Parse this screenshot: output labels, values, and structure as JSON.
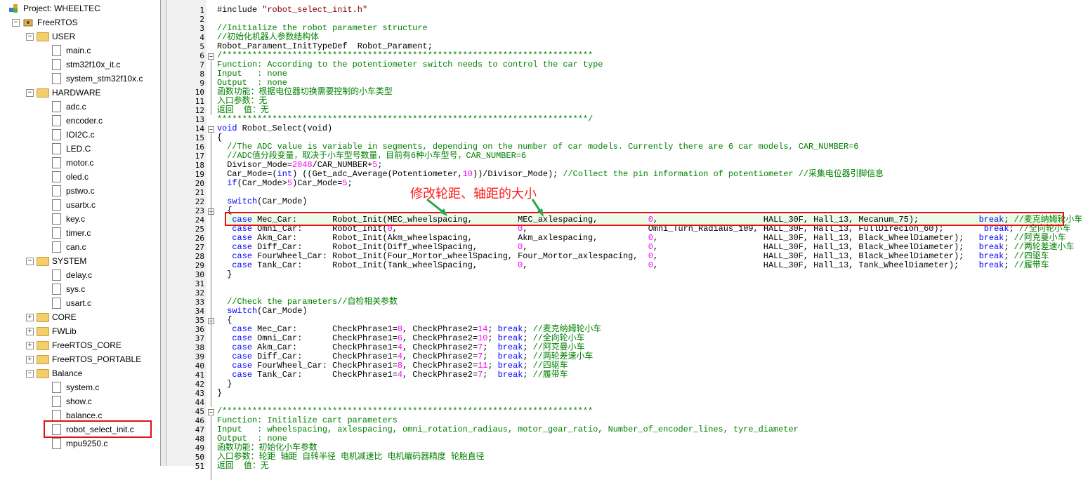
{
  "project": {
    "root_label": "Project: WHEELTEC",
    "target_label": "FreeRTOS",
    "groups": [
      {
        "name": "USER",
        "files": [
          "main.c",
          "stm32f10x_it.c",
          "system_stm32f10x.c"
        ]
      },
      {
        "name": "HARDWARE",
        "files": [
          "adc.c",
          "encoder.c",
          "IOI2C.c",
          "LED.C",
          "motor.c",
          "oled.c",
          "pstwo.c",
          "usartx.c",
          "key.c",
          "timer.c",
          "can.c"
        ]
      },
      {
        "name": "SYSTEM",
        "files": [
          "delay.c",
          "sys.c",
          "usart.c"
        ]
      },
      {
        "name": "CORE",
        "files": []
      },
      {
        "name": "FWLib",
        "files": []
      },
      {
        "name": "FreeRTOS_CORE",
        "files": []
      },
      {
        "name": "FreeRTOS_PORTABLE",
        "files": []
      },
      {
        "name": "Balance",
        "files": [
          "system.c",
          "show.c",
          "balance.c",
          "robot_select_init.c",
          "mpu9250.c"
        ]
      }
    ]
  },
  "annotation": "修改轮距、轴距的大小",
  "colors": {
    "comment": "#008000",
    "keyword": "#0000ff",
    "number": "#ff00ff",
    "highlight_border": "#e01010"
  },
  "code_lines": [
    [
      [
        "d",
        "#include "
      ],
      [
        "s",
        "\"robot_select_init.h\""
      ]
    ],
    [],
    [
      [
        "c",
        "//Initialize the robot parameter structure"
      ]
    ],
    [
      [
        "c",
        "//初始化机器人参数结构体"
      ]
    ],
    [
      [
        "d",
        "Robot_Parament_InitTypeDef  Robot_Parament;"
      ]
    ],
    [
      [
        "c",
        "/**************************************************************************"
      ]
    ],
    [
      [
        "c",
        "Function: According to the potentiometer switch needs to control the car type"
      ]
    ],
    [
      [
        "c",
        "Input   : none"
      ]
    ],
    [
      [
        "c",
        "Output  : none"
      ]
    ],
    [
      [
        "c",
        "函数功能：根据电位器切换需要控制的小车类型"
      ]
    ],
    [
      [
        "c",
        "入口参数：无"
      ]
    ],
    [
      [
        "c",
        "返回  值：无"
      ]
    ],
    [
      [
        "c",
        "**************************************************************************/"
      ]
    ],
    [
      [
        "k",
        "void"
      ],
      [
        "d",
        " Robot_Select(void)"
      ]
    ],
    [
      [
        "d",
        "{"
      ]
    ],
    [
      [
        "c",
        "  //The ADC value is variable in segments, depending on the number of car models. Currently there are 6 car models, CAR_NUMBER=6"
      ]
    ],
    [
      [
        "c",
        "  //ADC值分段变量，取决于小车型号数量，目前有6种小车型号，CAR_NUMBER=6"
      ]
    ],
    [
      [
        "d",
        "  Divisor_Mode="
      ],
      [
        "n",
        "2048"
      ],
      [
        "d",
        "/CAR_NUMBER+"
      ],
      [
        "n",
        "5"
      ],
      [
        "d",
        ";"
      ]
    ],
    [
      [
        "d",
        "  Car_Mode=("
      ],
      [
        "k",
        "int"
      ],
      [
        "d",
        ") ((Get_adc_Average(Potentiometer,"
      ],
      [
        "n",
        "10"
      ],
      [
        "d",
        "))/Divisor_Mode); "
      ],
      [
        "c",
        "//Collect the pin information of potentiometer //采集电位器引脚信息"
      ]
    ],
    [
      [
        "d",
        "  "
      ],
      [
        "k",
        "if"
      ],
      [
        "d",
        "(Car_Mode>"
      ],
      [
        "n",
        "5"
      ],
      [
        "d",
        ")Car_Mode="
      ],
      [
        "n",
        "5"
      ],
      [
        "d",
        ";"
      ]
    ],
    [],
    [
      [
        "d",
        "  "
      ],
      [
        "k",
        "switch"
      ],
      [
        "d",
        "(Car_Mode)"
      ]
    ],
    [
      [
        "d",
        "  {"
      ]
    ],
    [
      [
        "d",
        "   "
      ],
      [
        "k",
        "case"
      ],
      [
        "d",
        " Mec_Car:       Robot_Init(MEC_wheelspacing,         MEC_axlespacing,          "
      ],
      [
        "n",
        "0"
      ],
      [
        "d",
        ",                     HALL_30F, Hall_13, Mecanum_75);            "
      ],
      [
        "k",
        "break"
      ],
      [
        "d",
        "; "
      ],
      [
        "c",
        "//麦克纳姆轮小车"
      ]
    ],
    [
      [
        "d",
        "   "
      ],
      [
        "k",
        "case"
      ],
      [
        "d",
        " Omni_Car:      Robot_Init("
      ],
      [
        "n",
        "0"
      ],
      [
        "d",
        ",                        "
      ],
      [
        "n",
        "0"
      ],
      [
        "d",
        ",                        Omni_Turn_Radiaus_109, HALL_30F, Hall_13, FullDirecion_60);        "
      ],
      [
        "k",
        "break"
      ],
      [
        "d",
        "; "
      ],
      [
        "c",
        "//全向轮小车"
      ]
    ],
    [
      [
        "d",
        "   "
      ],
      [
        "k",
        "case"
      ],
      [
        "d",
        " Akm_Car:       Robot_Init(Akm_wheelspacing,         Akm_axlespacing,          "
      ],
      [
        "n",
        "0"
      ],
      [
        "d",
        ",                     HALL_30F, Hall_13, Black_WheelDiameter);   "
      ],
      [
        "k",
        "break"
      ],
      [
        "d",
        "; "
      ],
      [
        "c",
        "//阿克曼小车"
      ]
    ],
    [
      [
        "d",
        "   "
      ],
      [
        "k",
        "case"
      ],
      [
        "d",
        " Diff_Car:      Robot_Init(Diff_wheelSpacing,        "
      ],
      [
        "n",
        "0"
      ],
      [
        "d",
        ",                        "
      ],
      [
        "n",
        "0"
      ],
      [
        "d",
        ",                     HALL_30F, Hall_13, Black_WheelDiameter);   "
      ],
      [
        "k",
        "break"
      ],
      [
        "d",
        "; "
      ],
      [
        "c",
        "//两轮差速小车"
      ]
    ],
    [
      [
        "d",
        "   "
      ],
      [
        "k",
        "case"
      ],
      [
        "d",
        " FourWheel_Car: Robot_Init(Four_Mortor_wheelSpacing, Four_Mortor_axlespacing,  "
      ],
      [
        "n",
        "0"
      ],
      [
        "d",
        ",                     HALL_30F, Hall_13, Black_WheelDiameter);   "
      ],
      [
        "k",
        "break"
      ],
      [
        "d",
        "; "
      ],
      [
        "c",
        "//四驱车"
      ]
    ],
    [
      [
        "d",
        "   "
      ],
      [
        "k",
        "case"
      ],
      [
        "d",
        " Tank_Car:      Robot_Init(Tank_wheelSpacing,        "
      ],
      [
        "n",
        "0"
      ],
      [
        "d",
        ",                        "
      ],
      [
        "n",
        "0"
      ],
      [
        "d",
        ",                     HALL_30F, Hall_13, Tank_WheelDiameter);    "
      ],
      [
        "k",
        "break"
      ],
      [
        "d",
        "; "
      ],
      [
        "c",
        "//履带车"
      ]
    ],
    [
      [
        "d",
        "  }"
      ]
    ],
    [],
    [],
    [
      [
        "c",
        "  //Check the parameters//自检相关参数"
      ]
    ],
    [
      [
        "d",
        "  "
      ],
      [
        "k",
        "switch"
      ],
      [
        "d",
        "(Car_Mode)"
      ]
    ],
    [
      [
        "d",
        "  {"
      ]
    ],
    [
      [
        "d",
        "   "
      ],
      [
        "k",
        "case"
      ],
      [
        "d",
        " Mec_Car:       CheckPhrase1="
      ],
      [
        "n",
        "8"
      ],
      [
        "d",
        ", CheckPhrase2="
      ],
      [
        "n",
        "14"
      ],
      [
        "d",
        "; "
      ],
      [
        "k",
        "break"
      ],
      [
        "d",
        "; "
      ],
      [
        "c",
        "//麦克纳姆轮小车"
      ]
    ],
    [
      [
        "d",
        "   "
      ],
      [
        "k",
        "case"
      ],
      [
        "d",
        " Omni_Car:      CheckPhrase1="
      ],
      [
        "n",
        "6"
      ],
      [
        "d",
        ", CheckPhrase2="
      ],
      [
        "n",
        "10"
      ],
      [
        "d",
        "; "
      ],
      [
        "k",
        "break"
      ],
      [
        "d",
        "; "
      ],
      [
        "c",
        "//全向轮小车"
      ]
    ],
    [
      [
        "d",
        "   "
      ],
      [
        "k",
        "case"
      ],
      [
        "d",
        " Akm_Car:       CheckPhrase1="
      ],
      [
        "n",
        "4"
      ],
      [
        "d",
        ", CheckPhrase2="
      ],
      [
        "n",
        "7"
      ],
      [
        "d",
        ";  "
      ],
      [
        "k",
        "break"
      ],
      [
        "d",
        "; "
      ],
      [
        "c",
        "//阿克曼小车"
      ]
    ],
    [
      [
        "d",
        "   "
      ],
      [
        "k",
        "case"
      ],
      [
        "d",
        " Diff_Car:      CheckPhrase1="
      ],
      [
        "n",
        "4"
      ],
      [
        "d",
        ", CheckPhrase2="
      ],
      [
        "n",
        "7"
      ],
      [
        "d",
        ";  "
      ],
      [
        "k",
        "break"
      ],
      [
        "d",
        "; "
      ],
      [
        "c",
        "//两轮差速小车"
      ]
    ],
    [
      [
        "d",
        "   "
      ],
      [
        "k",
        "case"
      ],
      [
        "d",
        " FourWheel_Car: CheckPhrase1="
      ],
      [
        "n",
        "8"
      ],
      [
        "d",
        ", CheckPhrase2="
      ],
      [
        "n",
        "11"
      ],
      [
        "d",
        "; "
      ],
      [
        "k",
        "break"
      ],
      [
        "d",
        "; "
      ],
      [
        "c",
        "//四驱车"
      ]
    ],
    [
      [
        "d",
        "   "
      ],
      [
        "k",
        "case"
      ],
      [
        "d",
        " Tank_Car:      CheckPhrase1="
      ],
      [
        "n",
        "4"
      ],
      [
        "d",
        ", CheckPhrase2="
      ],
      [
        "n",
        "7"
      ],
      [
        "d",
        ";  "
      ],
      [
        "k",
        "break"
      ],
      [
        "d",
        "; "
      ],
      [
        "c",
        "//履带车"
      ]
    ],
    [
      [
        "d",
        "  }"
      ]
    ],
    [
      [
        "d",
        "}"
      ]
    ],
    [],
    [
      [
        "c",
        "/**************************************************************************"
      ]
    ],
    [
      [
        "c",
        "Function: Initialize cart parameters"
      ]
    ],
    [
      [
        "c",
        "Input   : wheelspacing, axlespacing, omni_rotation_radiaus, motor_gear_ratio, Number_of_encoder_lines, tyre_diameter"
      ]
    ],
    [
      [
        "c",
        "Output  : none"
      ]
    ],
    [
      [
        "c",
        "函数功能：初始化小车参数"
      ]
    ],
    [
      [
        "c",
        "入口参数：轮距 轴距 自转半径 电机减速比 电机编码器精度 轮胎直径"
      ]
    ],
    [
      [
        "c",
        "返回  值：无"
      ]
    ]
  ]
}
